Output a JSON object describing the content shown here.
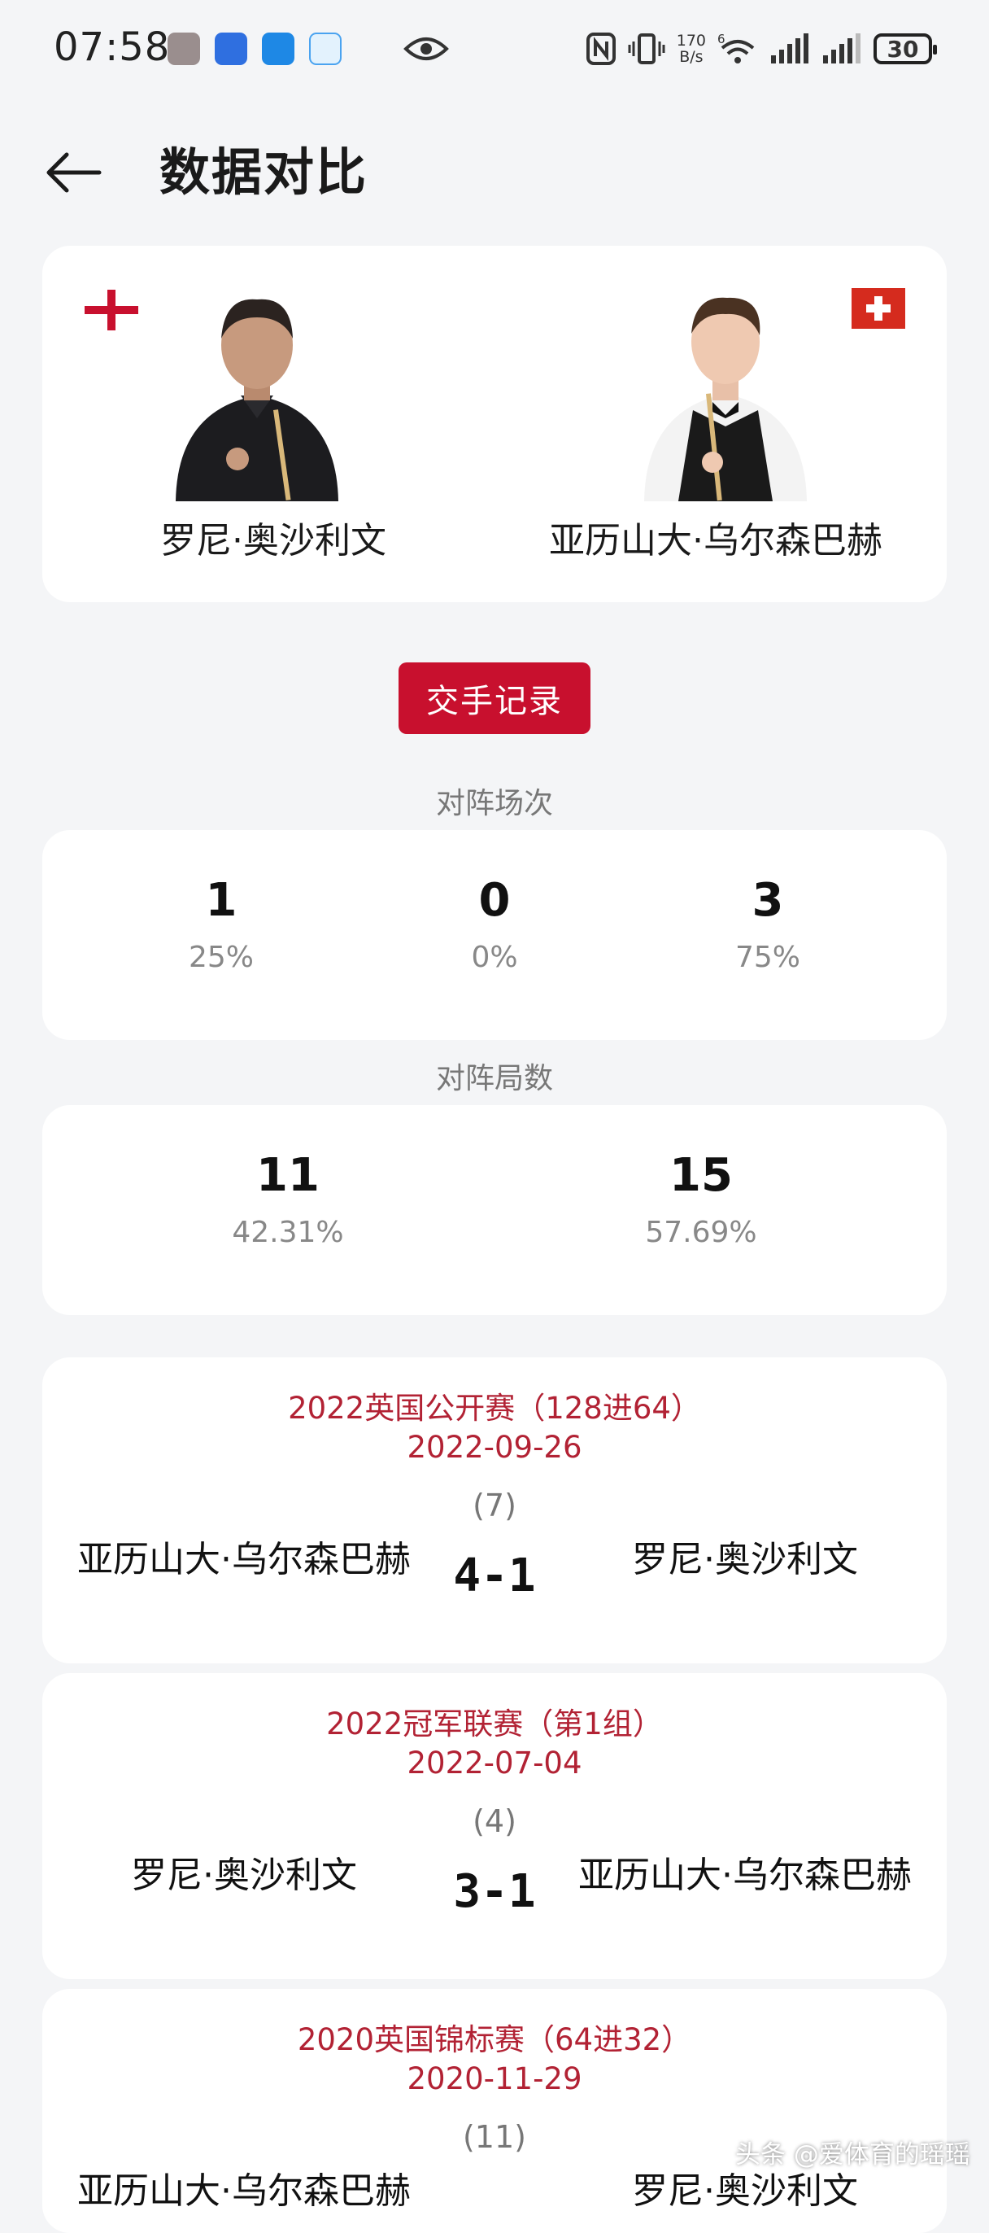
{
  "status_bar": {
    "time": "07:58",
    "network_speed_value": "170",
    "network_speed_unit": "B/s",
    "wifi_label": "6",
    "battery": "30"
  },
  "header": {
    "title": "数据对比"
  },
  "players": {
    "left": {
      "name": "罗尼·奥沙利文",
      "flag": "england-flag-icon"
    },
    "right": {
      "name": "亚历山大·乌尔森巴赫",
      "flag": "switzerland-flag-icon"
    }
  },
  "h2h_button": "交手记录",
  "matches_summary": {
    "label": "对阵场次",
    "left": {
      "value": "1",
      "pct": "25%"
    },
    "draw": {
      "value": "0",
      "pct": "0%"
    },
    "right": {
      "value": "3",
      "pct": "75%"
    }
  },
  "frames_summary": {
    "label": "对阵局数",
    "left": {
      "value": "11",
      "pct": "42.31%"
    },
    "right": {
      "value": "15",
      "pct": "57.69%"
    }
  },
  "matches": [
    {
      "event": "2022英国公开赛（128进64）",
      "date": "2022-09-26",
      "frames": "(7)",
      "player1": "亚历山大·乌尔森巴赫",
      "score": "4-1",
      "player2": "罗尼·奥沙利文"
    },
    {
      "event": "2022冠军联赛（第1组）",
      "date": "2022-07-04",
      "frames": "(4)",
      "player1": "罗尼·奥沙利文",
      "score": "3-1",
      "player2": "亚历山大·乌尔森巴赫"
    },
    {
      "event": "2020英国锦标赛（64进32）",
      "date": "2020-11-29",
      "frames": "(11)",
      "player1": "亚历山大·乌尔森巴赫",
      "score": "",
      "player2": "罗尼·奥沙利文"
    }
  ],
  "watermark": "头条 @爱体育的瑶瑶",
  "colors": {
    "accent": "#c8102e",
    "event_text": "#b22234",
    "background": "#f4f5f7"
  }
}
